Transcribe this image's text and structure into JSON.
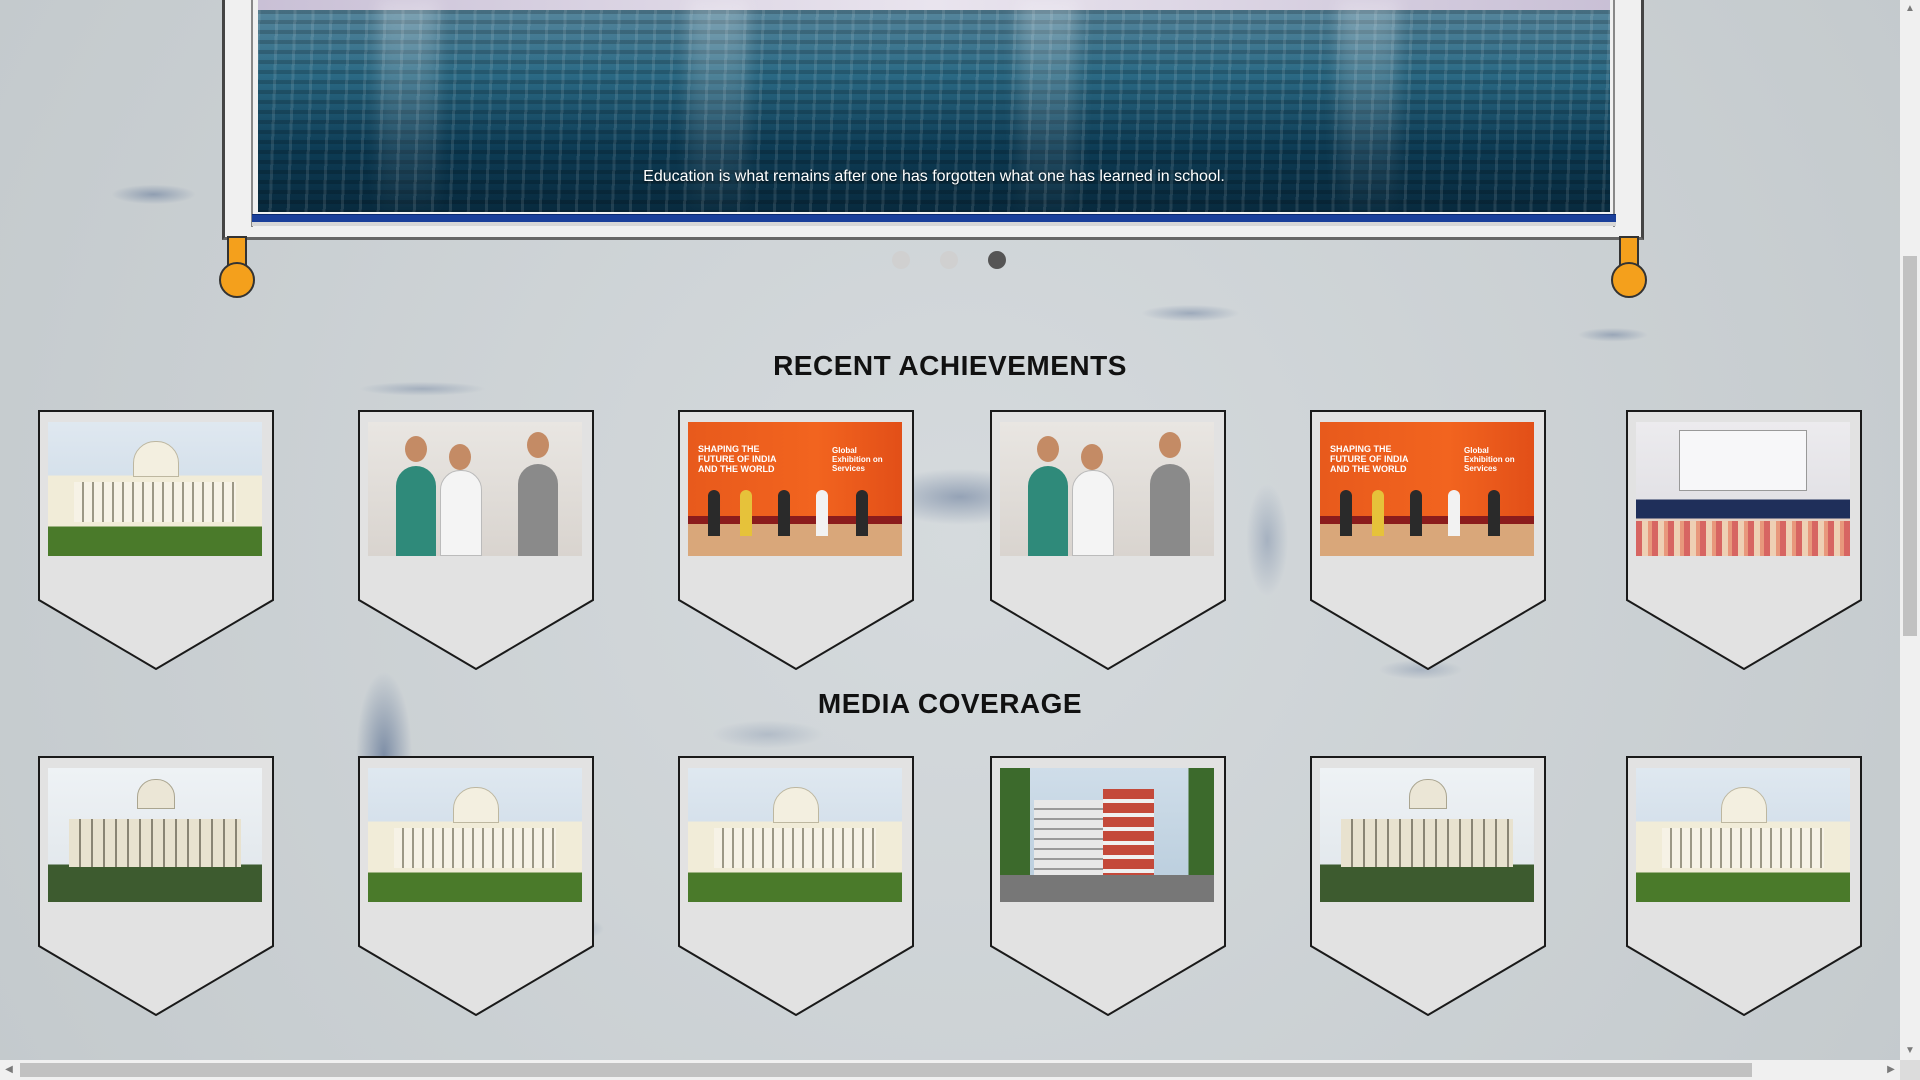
{
  "hero": {
    "caption": "Education is what remains after one has forgotten what one has learned in school.",
    "slides": [
      {
        "label": "slide-1",
        "active": false
      },
      {
        "label": "slide-2",
        "active": false
      },
      {
        "label": "slide-3",
        "active": true
      }
    ]
  },
  "sections": {
    "achievements_title": "RECENT ACHIEVEMENTS",
    "media_title": "MEDIA COVERAGE"
  },
  "achievements": [
    {
      "image": "main-building-photo"
    },
    {
      "image": "researchers-lab-photo"
    },
    {
      "image": "exhibition-stage-photo",
      "banner": "SHAPING THE FUTURE OF INDIA AND THE WORLD",
      "banner2": "Global Exhibition on Services"
    },
    {
      "image": "researchers-lab-photo"
    },
    {
      "image": "exhibition-stage-photo",
      "banner": "SHAPING THE FUTURE OF INDIA AND THE WORLD",
      "banner2": "Global Exhibition on Services"
    },
    {
      "image": "panel-event-photo"
    }
  ],
  "media": [
    {
      "image": "main-building-front-photo"
    },
    {
      "image": "main-building-garden-photo"
    },
    {
      "image": "main-building-photo"
    },
    {
      "image": "modern-building-photo"
    },
    {
      "image": "main-building-front-photo"
    },
    {
      "image": "main-building-garden-photo"
    }
  ],
  "colors": {
    "knob": "#f4a01c",
    "blue_bar": "#1a3f9a",
    "dot_active": "#555555",
    "dot_inactive": "#d0d0d0"
  }
}
